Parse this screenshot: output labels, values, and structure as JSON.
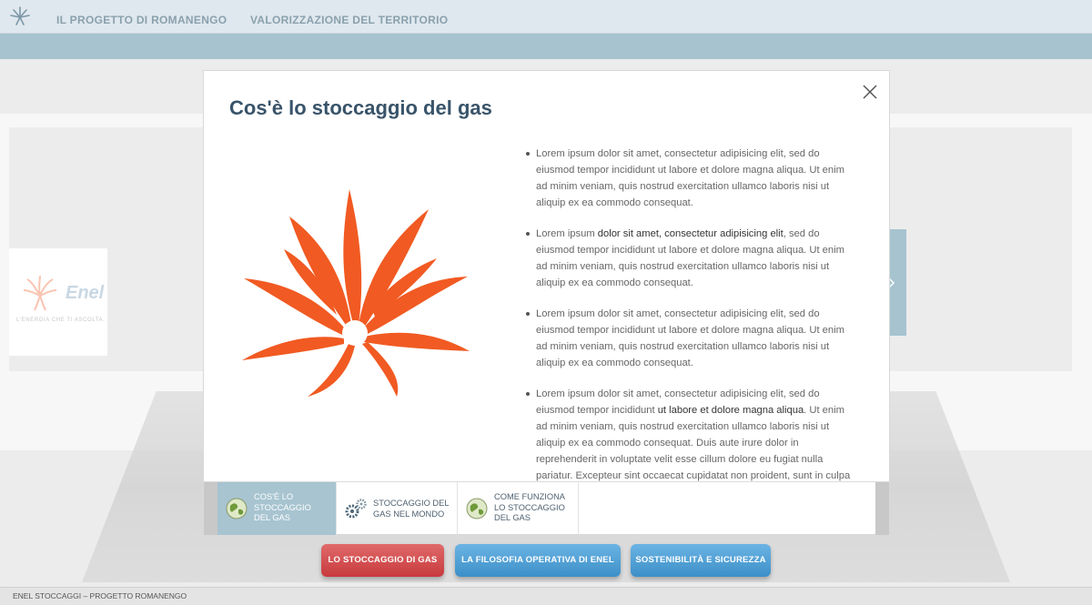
{
  "nav": {
    "items": [
      "IL PROGETTO DI ROMANENGO",
      "VALORIZZAZIONE DEL TERRITORIO"
    ]
  },
  "background": {
    "enel_brand": "Enel",
    "enel_tagline": "L'ENERGIA CHE TI ASCOLTA."
  },
  "modal": {
    "title": "Cos'è lo stoccaggio del gas",
    "bullets": [
      {
        "pre": "Lorem ipsum dolor sit amet, consectetur adipisicing elit, sed do eiusmod tempor incididunt ut labore et dolore magna aliqua. Ut enim ad minim veniam, quis nostrud exercitation ullamco laboris nisi ut aliquip ex ea commodo consequat.",
        "bold": "",
        "post": ""
      },
      {
        "pre": "Lorem ipsum ",
        "bold": "dolor sit amet, consectetur adipisicing elit",
        "post": ", sed do eiusmod tempor incididunt ut labore et dolore magna aliqua. Ut enim ad minim veniam, quis nostrud exercitation ullamco laboris nisi ut aliquip ex ea commodo consequat."
      },
      {
        "pre": "Lorem ipsum dolor sit amet, consectetur adipisicing elit, sed do eiusmod tempor incididunt ut labore et dolore magna aliqua. Ut enim ad minim veniam, quis nostrud exercitation ullamco laboris nisi ut aliquip ex ea commodo consequat.",
        "bold": "",
        "post": ""
      },
      {
        "pre": "Lorem ipsum dolor sit amet, consectetur adipisicing elit, sed do eiusmod tempor incididunt ",
        "bold": "ut labore et dolore magna aliqua",
        "post": ". Ut enim ad minim veniam, quis nostrud exercitation ullamco laboris nisi ut aliquip ex ea commodo consequat. Duis aute irure dolor in reprehenderit in voluptate velit esse cillum dolore eu fugiat nulla pariatur. Excepteur sint occaecat cupidatat non proident, sunt in culpa qui officia deserunt mollit anim id est laborum."
      }
    ],
    "tabs": [
      {
        "label": "COS'È LO STOCCAGGIO DEL GAS",
        "icon": "globe-icon",
        "active": true
      },
      {
        "label": "STOCCAGGIO DEL GAS NEL MONDO",
        "icon": "gears-icon",
        "active": false
      },
      {
        "label": "COME FUNZIONA LO STOCCAGGIO DEL GAS",
        "icon": "globe-icon",
        "active": false
      }
    ]
  },
  "buttons": [
    {
      "label": "LO STOCCAGGIO DI GAS",
      "color": "#c83a3d"
    },
    {
      "label": "LA FILOSOFIA OPERATIVA DI ENEL",
      "color": "#3d8fc8"
    },
    {
      "label": "SOSTENIBILITÀ E SICUREZZA",
      "color": "#3d8fc8"
    }
  ],
  "footer": {
    "text": "ENEL STOCCAGGI – PROGETTO ROMANENGO"
  },
  "colors": {
    "accent_orange": "#f15a22",
    "nav_blue": "#a6c3cf",
    "title_blue": "#39546a"
  }
}
